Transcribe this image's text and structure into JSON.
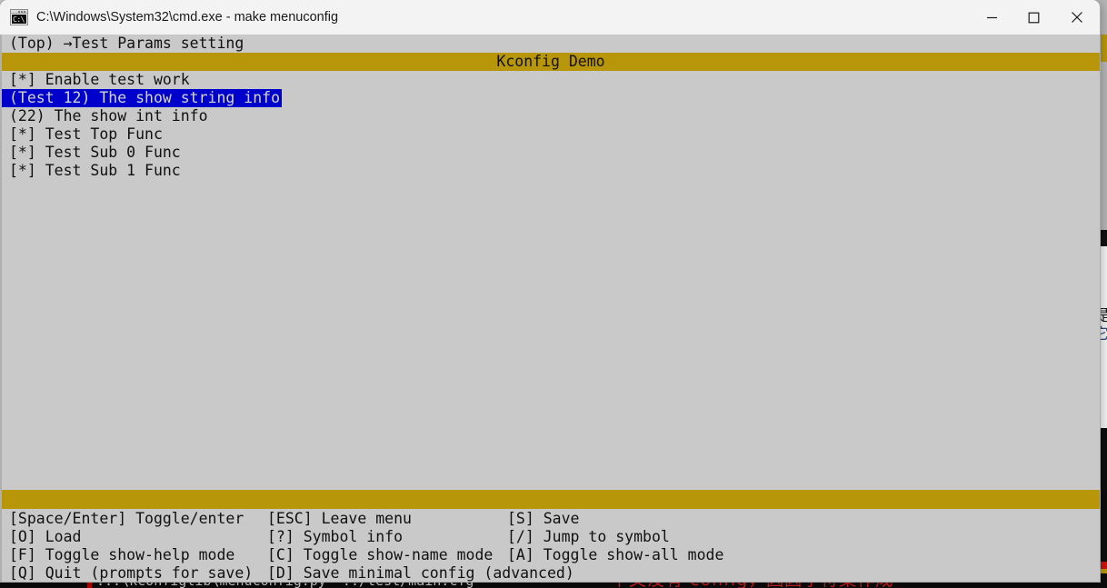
{
  "window": {
    "title": "C:\\Windows\\System32\\cmd.exe - make  menuconfig",
    "icon_name": "cmd-exe-icon",
    "icon_text": "C:\\",
    "controls": {
      "minimize_label": "Minimize",
      "maximize_label": "Maximize",
      "close_label": "Close"
    }
  },
  "colors": {
    "gold_bar": "#b8960a",
    "terminal_bg": "#c9c9c9",
    "selection_bg": "#0000cc",
    "selection_fg": "#d5d5d5",
    "text": "#111111",
    "console_red": "#d32020"
  },
  "terminal": {
    "breadcrumb": "(Top) →Test Params setting",
    "header_title": "Kconfig Demo",
    "menu_items": [
      {
        "prefix": "[*]",
        "label": "Enable test work",
        "selected": false
      },
      {
        "prefix": "(Test 12)",
        "label": "The show string info",
        "selected": true
      },
      {
        "prefix": "(22)",
        "label": "The show int info",
        "selected": false
      },
      {
        "prefix": "[*]",
        "label": "Test Top Func",
        "selected": false
      },
      {
        "prefix": "[*]",
        "label": "Test Sub 0 Func",
        "selected": false
      },
      {
        "prefix": "[*]",
        "label": "Test Sub 1 Func",
        "selected": false
      }
    ],
    "menu_lines": [
      "[*] Enable test work",
      "(Test 12) The show string info",
      "(22) The show int info",
      "[*] Test Top Func",
      "[*] Test Sub 0 Func",
      "[*] Test Sub 1 Func"
    ]
  },
  "help": {
    "rows": [
      {
        "col1": "[Space/Enter] Toggle/enter",
        "col2": "[ESC] Leave menu",
        "col3": "[S] Save"
      },
      {
        "col1": "[O] Load",
        "col2": "[?] Symbol info",
        "col3": "[/] Jump to symbol"
      },
      {
        "col1": "[F] Toggle show-help mode",
        "col2": "[C] Toggle show-name mode",
        "col3": "[A] Toggle show-all mode"
      },
      {
        "col1": "[Q] Quit (prompts for save)",
        "col2": "[D] Save minimal config (advanced)",
        "col3": ""
      }
    ]
  },
  "background": {
    "console_text": "...\\kconfiglib\\menuconfig.py '../test/main.cfg'",
    "console_cjk": "中文没有 config，因因字符集作成",
    "side_cjk_1": "提",
    "side_cjk_2": "它"
  }
}
